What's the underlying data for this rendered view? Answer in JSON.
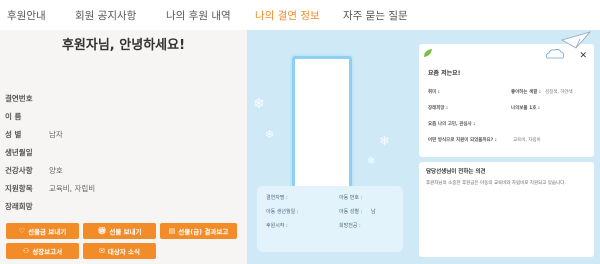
{
  "nav": {
    "items": [
      {
        "label": "후원안내"
      },
      {
        "label": "회원 공지사항"
      },
      {
        "label": "나의 후원 내역"
      },
      {
        "label": "나의 결연 정보"
      },
      {
        "label": "자주 묻는 질문"
      }
    ],
    "active_index": 3
  },
  "left": {
    "greeting": "후원자님, 안녕하세요!",
    "rows": [
      {
        "label": "결연번호",
        "value": ""
      },
      {
        "label": "이 름",
        "value": ""
      },
      {
        "label": "성 별",
        "value": "남자"
      },
      {
        "label": "생년월일",
        "value": ""
      },
      {
        "label": "건강사항",
        "value": "양호"
      },
      {
        "label": "지원항목",
        "value": "교육비, 자립비"
      },
      {
        "label": "장래희망",
        "value": ""
      }
    ],
    "buttons": [
      {
        "label": "선물금 보내기",
        "icon": "heart-icon"
      },
      {
        "label": "선물 보내기",
        "icon": "gift-icon"
      },
      {
        "label": "선물(금) 결과보고",
        "icon": "document-icon"
      },
      {
        "label": "성장보고서",
        "icon": "person-icon"
      },
      {
        "label": "대상자 소식",
        "icon": "mail-icon"
      }
    ]
  },
  "card": {
    "fields": [
      {
        "label": "결연자명 :",
        "value": ""
      },
      {
        "label": "아동 번호 :",
        "value": ""
      },
      {
        "label": "아동 생년월일 :",
        "value": ""
      },
      {
        "label": "아동 성별 :",
        "value": "남"
      },
      {
        "label": "후원시작 :",
        "value": ""
      },
      {
        "label": "희망전공 :",
        "value": ""
      }
    ]
  },
  "summary": {
    "title": "요즘 저는요!",
    "rows": [
      {
        "label": "취미 :",
        "value": ""
      },
      {
        "label": "좋아하는 색깔 :",
        "value": "검정색, 하얀색"
      },
      {
        "label": "장래희망 :",
        "value": ""
      },
      {
        "label": "나의보물 1호 :",
        "value": ""
      },
      {
        "label": "요즘 나의 고민, 관심사 :",
        "value": ""
      },
      {
        "label": "어떤 방식으로 지원이 되었을까요? :",
        "value": "교육비, 자립비"
      }
    ]
  },
  "letter": {
    "title": "담당선생님이 전하는 의견",
    "body": "후원자님의 소중한 후원금은 아동의 교육비와 자립비로 지원되고 있습니다."
  },
  "colors": {
    "accent": "#f28c28",
    "panel_blue": "#cfe9f7",
    "frame_blue": "#8fd0f2"
  }
}
